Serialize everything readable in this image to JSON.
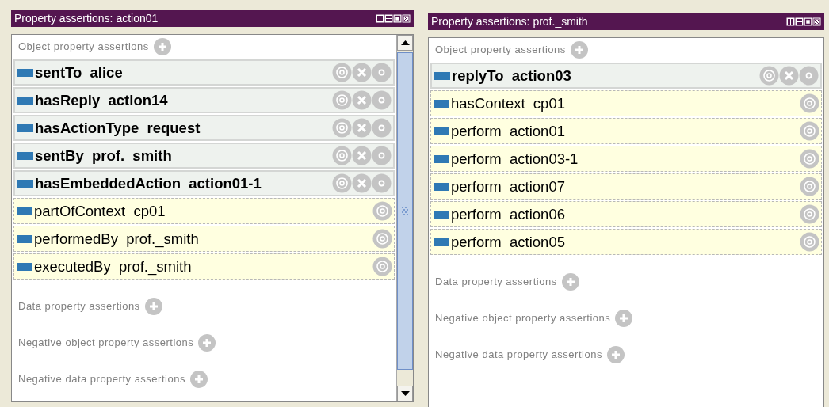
{
  "panels": [
    {
      "title": "Property assertions: action01",
      "scrollbar": true,
      "sections": [
        {
          "label": "Object property assertions",
          "rows": [
            {
              "kind": "asserted",
              "text": "sentTo  alice"
            },
            {
              "kind": "asserted",
              "text": "hasReply  action14"
            },
            {
              "kind": "asserted",
              "text": "hasActionType  request"
            },
            {
              "kind": "asserted",
              "text": "sentBy  prof._smith"
            },
            {
              "kind": "asserted",
              "text": "hasEmbeddedAction  action01-1"
            },
            {
              "kind": "inferred",
              "text": "partOfContext  cp01"
            },
            {
              "kind": "inferred",
              "text": "performedBy  prof._smith"
            },
            {
              "kind": "inferred",
              "text": "executedBy  prof._smith"
            }
          ]
        },
        {
          "label": "Data property assertions"
        },
        {
          "label": "Negative object property assertions"
        },
        {
          "label": "Negative data property assertions"
        }
      ]
    },
    {
      "title": "Property assertions: prof._smith",
      "scrollbar": false,
      "sections": [
        {
          "label": "Object property assertions",
          "rows": [
            {
              "kind": "asserted",
              "text": "replyTo  action03"
            },
            {
              "kind": "inferred",
              "text": "hasContext  cp01"
            },
            {
              "kind": "inferred",
              "text": "perform  action01"
            },
            {
              "kind": "inferred",
              "text": "perform  action03-1"
            },
            {
              "kind": "inferred",
              "text": "perform  action07"
            },
            {
              "kind": "inferred",
              "text": "perform  action06"
            },
            {
              "kind": "inferred",
              "text": "perform  action05"
            }
          ]
        },
        {
          "label": "Data property assertions"
        },
        {
          "label": "Negative object property assertions"
        },
        {
          "label": "Negative data property assertions"
        }
      ]
    }
  ]
}
